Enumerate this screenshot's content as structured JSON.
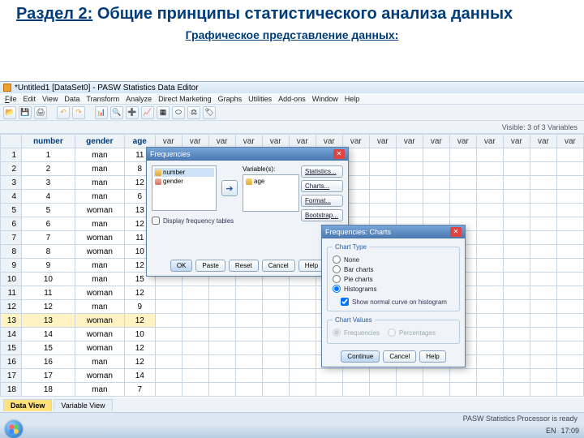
{
  "slide": {
    "section_label": "Раздел 2:",
    "section_title": "Общие принципы статистического анализа данных",
    "subtitle": "Графическое представление данных:"
  },
  "window": {
    "title": "*Untitled1 [DataSet0] - PASW Statistics Data Editor"
  },
  "menu": {
    "file": "File",
    "edit": "Edit",
    "view": "View",
    "data": "Data",
    "transform": "Transform",
    "analyze": "Analyze",
    "direct": "Direct Marketing",
    "graphs": "Graphs",
    "utilities": "Utilities",
    "addons": "Add-ons",
    "window": "Window",
    "help": "Help"
  },
  "visible_label": "Visible: 3 of 3 Variables",
  "columns": {
    "number": "number",
    "gender": "gender",
    "age": "age",
    "var": "var"
  },
  "rows": [
    {
      "n": 1,
      "number": 1,
      "gender": "man",
      "age": 11
    },
    {
      "n": 2,
      "number": 2,
      "gender": "man",
      "age": 8
    },
    {
      "n": 3,
      "number": 3,
      "gender": "man",
      "age": 12
    },
    {
      "n": 4,
      "number": 4,
      "gender": "man",
      "age": 6
    },
    {
      "n": 5,
      "number": 5,
      "gender": "woman",
      "age": 13
    },
    {
      "n": 6,
      "number": 6,
      "gender": "man",
      "age": 12
    },
    {
      "n": 7,
      "number": 7,
      "gender": "woman",
      "age": 11
    },
    {
      "n": 8,
      "number": 8,
      "gender": "woman",
      "age": 10
    },
    {
      "n": 9,
      "number": 9,
      "gender": "man",
      "age": 12
    },
    {
      "n": 10,
      "number": 10,
      "gender": "man",
      "age": 15
    },
    {
      "n": 11,
      "number": 11,
      "gender": "woman",
      "age": 12
    },
    {
      "n": 12,
      "number": 12,
      "gender": "man",
      "age": 9
    },
    {
      "n": 13,
      "number": 13,
      "gender": "woman",
      "age": 12
    },
    {
      "n": 14,
      "number": 14,
      "gender": "woman",
      "age": 10
    },
    {
      "n": 15,
      "number": 15,
      "gender": "woman",
      "age": 12
    },
    {
      "n": 16,
      "number": 16,
      "gender": "man",
      "age": 12
    },
    {
      "n": 17,
      "number": 17,
      "gender": "woman",
      "age": 14
    },
    {
      "n": 18,
      "number": 18,
      "gender": "man",
      "age": 7
    }
  ],
  "tabs": {
    "data": "Data View",
    "variable": "Variable View"
  },
  "status": "PASW Statistics Processor is ready",
  "dlg_freq": {
    "title": "Frequencies",
    "variables_label": "Variable(s):",
    "left_items": {
      "number": "number",
      "gender": "gender"
    },
    "right_items": {
      "age": "age"
    },
    "side": {
      "stat": "Statistics...",
      "charts": "Charts...",
      "format": "Format...",
      "boot": "Bootstrap..."
    },
    "display_chk": "Display frequency tables",
    "buttons": {
      "ok": "OK",
      "paste": "Paste",
      "reset": "Reset",
      "cancel": "Cancel",
      "help": "Help"
    }
  },
  "dlg_charts": {
    "title": "Frequencies: Charts",
    "close_label": "✕",
    "group1": "Chart Type",
    "opts": {
      "none": "None",
      "bar": "Bar charts",
      "pie": "Pie charts",
      "hist": "Histograms"
    },
    "normal_chk": "Show normal curve on histogram",
    "group2": "Chart Values",
    "vals": {
      "freq": "Frequencies",
      "perc": "Percentages"
    },
    "buttons": {
      "cont": "Continue",
      "cancel": "Cancel",
      "help": "Help"
    }
  },
  "tray": {
    "lang": "EN",
    "time": "17:09"
  }
}
